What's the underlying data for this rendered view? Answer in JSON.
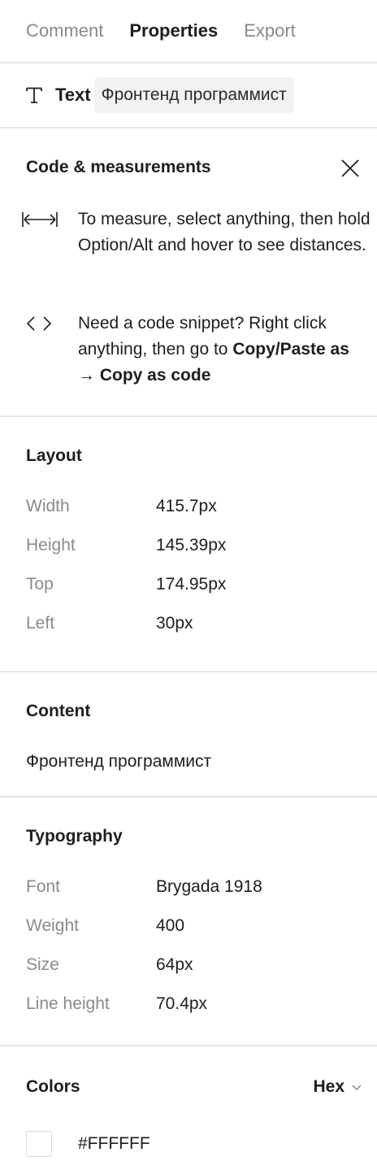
{
  "tabs": [
    {
      "label": "Comment",
      "active": false
    },
    {
      "label": "Properties",
      "active": true
    },
    {
      "label": "Export",
      "active": false
    }
  ],
  "selection": {
    "kind": "Text",
    "name": "Фронтенд программист",
    "icon": "text-type-icon"
  },
  "code_measurements": {
    "title": "Code & measurements",
    "tip1": "To measure, select anything, then hold Option/Alt and hover to see distances.",
    "tip2_prefix": "Need a code snippet? Right click anything, then go to ",
    "tip2_bold1": "Copy/Paste as",
    "tip2_arrow": " → ",
    "tip2_bold2": "Copy as code"
  },
  "layout": {
    "title": "Layout",
    "rows": [
      {
        "key": "Width",
        "value": "415.7px"
      },
      {
        "key": "Height",
        "value": "145.39px"
      },
      {
        "key": "Top",
        "value": "174.95px"
      },
      {
        "key": "Left",
        "value": "30px"
      }
    ]
  },
  "content": {
    "title": "Content",
    "text": "Фронтенд программист"
  },
  "typography": {
    "title": "Typography",
    "rows": [
      {
        "key": "Font",
        "value": "Brygada 1918"
      },
      {
        "key": "Weight",
        "value": "400"
      },
      {
        "key": "Size",
        "value": "64px"
      },
      {
        "key": "Line height",
        "value": "70.4px"
      }
    ]
  },
  "colors": {
    "title": "Colors",
    "format": "Hex",
    "items": [
      {
        "hex": "#FFFFFF"
      }
    ]
  }
}
